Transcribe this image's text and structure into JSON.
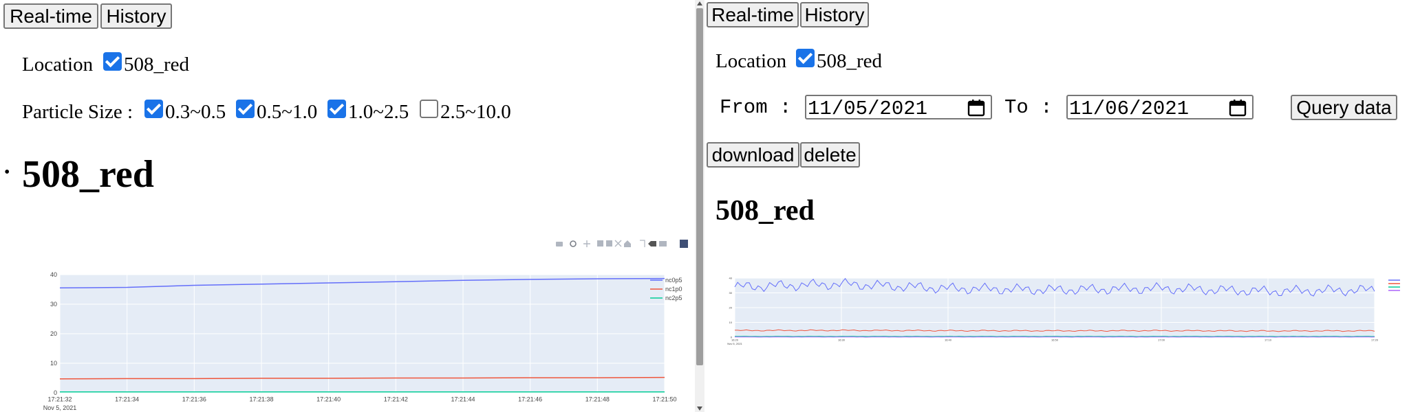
{
  "left": {
    "buttons": {
      "realtime": "Real-time",
      "history": "History"
    },
    "location_label": "Location",
    "location_value": "508_red",
    "particle_label": "Particle Size :",
    "particle_options": [
      {
        "label": "0.3~0.5",
        "checked": true
      },
      {
        "label": "0.5~1.0",
        "checked": true
      },
      {
        "label": "1.0~2.5",
        "checked": true
      },
      {
        "label": "2.5~10.0",
        "checked": false
      }
    ],
    "bullet_heading": "508_red",
    "modebar_icons": [
      "camera-icon",
      "zoom-icon",
      "pan-icon",
      "zoom-in-icon",
      "zoom-out-icon",
      "autoscale-icon",
      "reset-axes-icon",
      "spike-lines-icon",
      "hover-closest-icon",
      "hover-compare-icon",
      "plotly-logo-icon"
    ]
  },
  "right": {
    "buttons": {
      "realtime": "Real-time",
      "history": "History"
    },
    "location_label": "Location",
    "location_value": "508_red",
    "from_label": "From :",
    "from_value": "11/05/2021",
    "to_label": "To :",
    "to_value": "11/06/2021",
    "query_label": "Query data",
    "download_label": "download",
    "delete_label": "delete",
    "heading": "508_red"
  },
  "chart_data": [
    {
      "type": "line",
      "x": [
        "17:21:32",
        "17:21:34",
        "17:21:36",
        "17:21:38",
        "17:21:40",
        "17:21:42",
        "17:21:44",
        "17:21:46",
        "17:21:48",
        "17:21:50"
      ],
      "x_date_label": "Nov 5, 2021",
      "ylim": [
        0,
        40
      ],
      "yticks": [
        0,
        10,
        20,
        30,
        40
      ],
      "grid": true,
      "legend_position": "top-right",
      "series": [
        {
          "name": "nc0p5",
          "color": "#636efa",
          "values": [
            35.5,
            35.7,
            36.4,
            36.8,
            37.2,
            37.6,
            38.1,
            38.4,
            38.6,
            38.7
          ]
        },
        {
          "name": "nc1p0",
          "color": "#ef553b",
          "values": [
            4.7,
            4.8,
            4.8,
            4.9,
            4.9,
            5.0,
            5.0,
            5.1,
            5.1,
            5.2
          ]
        },
        {
          "name": "nc2p5",
          "color": "#00cc96",
          "values": [
            0.3,
            0.3,
            0.3,
            0.3,
            0.3,
            0.3,
            0.3,
            0.3,
            0.3,
            0.3
          ]
        }
      ]
    },
    {
      "type": "line",
      "x": [
        "16:20",
        "16:30",
        "16:40",
        "16:50",
        "17:00",
        "17:10",
        "17:20"
      ],
      "x_date_label": "Nov 5, 2021",
      "ylim": [
        0,
        40
      ],
      "yticks": [
        0,
        10,
        20,
        30,
        40
      ],
      "grid": true,
      "legend_position": "top-right",
      "series": [
        {
          "name": "nc0p5",
          "color": "#636efa",
          "values": [
            34,
            36,
            33,
            32,
            33,
            31,
            32
          ]
        },
        {
          "name": "nc1p0",
          "color": "#ef553b",
          "values": [
            4.5,
            4.6,
            4.4,
            4.3,
            4.4,
            4.2,
            4.3
          ]
        },
        {
          "name": "nc2p5",
          "color": "#00cc96",
          "values": [
            0.5,
            0.5,
            0.5,
            0.5,
            0.5,
            0.5,
            0.5
          ]
        },
        {
          "name": "nc10p0",
          "color": "#ab63fa",
          "values": [
            0.1,
            0.1,
            0.1,
            0.1,
            0.1,
            0.1,
            0.1
          ]
        }
      ]
    }
  ]
}
